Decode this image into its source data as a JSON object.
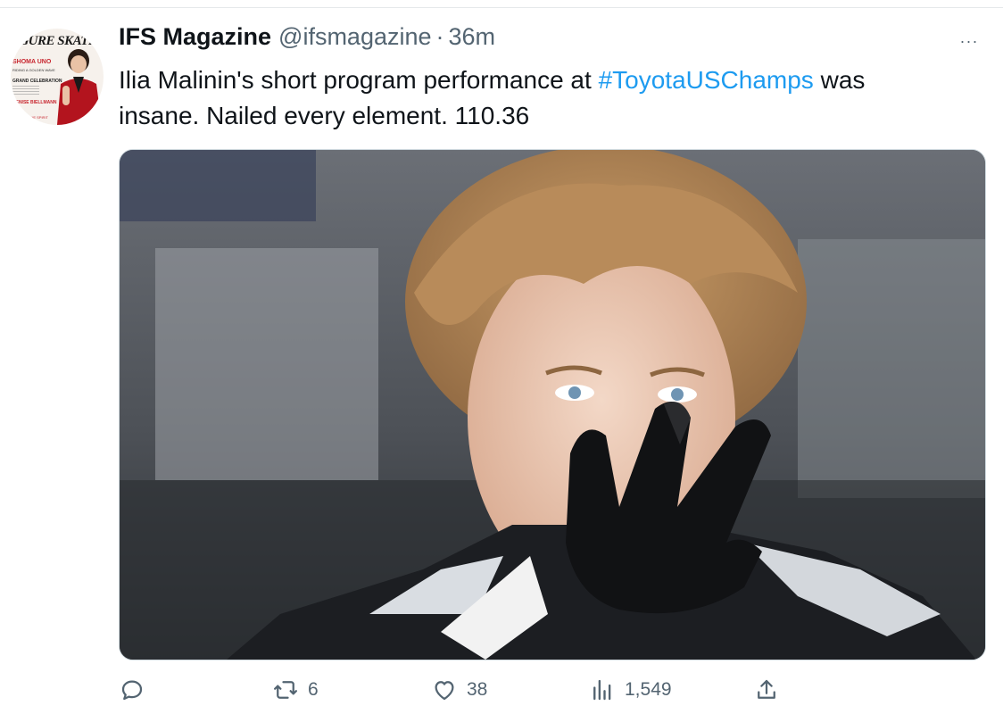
{
  "tweet": {
    "author": {
      "display_name": "IFS Magazine",
      "handle": "@ifsmagazine",
      "avatar_cover": {
        "masthead": "IGURE SKATIN",
        "feature_name": "SHOMA UNO",
        "feature_sub": "RIDING A GOLDEN WAVE",
        "celebration": "GRAND CELEBRATION",
        "guest": "DENISE BIELLMANN",
        "spirit": "THE SPIRIT"
      }
    },
    "separator": "·",
    "timestamp": "36m",
    "text": {
      "before": "Ilia Malinin's short program performance at ",
      "hashtag": "#ToyotaUSChamps",
      "after": " was insane. Nailed every element. 110.36"
    },
    "media": {
      "description_icon": "photo"
    },
    "actions": {
      "reply": {
        "icon": "reply-icon",
        "count": ""
      },
      "retweet": {
        "icon": "retweet-icon",
        "count": "6"
      },
      "like": {
        "icon": "heart-icon",
        "count": "38"
      },
      "views": {
        "icon": "views-icon",
        "count": "1,549"
      },
      "share": {
        "icon": "share-icon",
        "count": ""
      }
    },
    "more_label": "···"
  },
  "colors": {
    "link": "#1d9bf0",
    "secondary": "#536471",
    "primary": "#0f1419"
  }
}
